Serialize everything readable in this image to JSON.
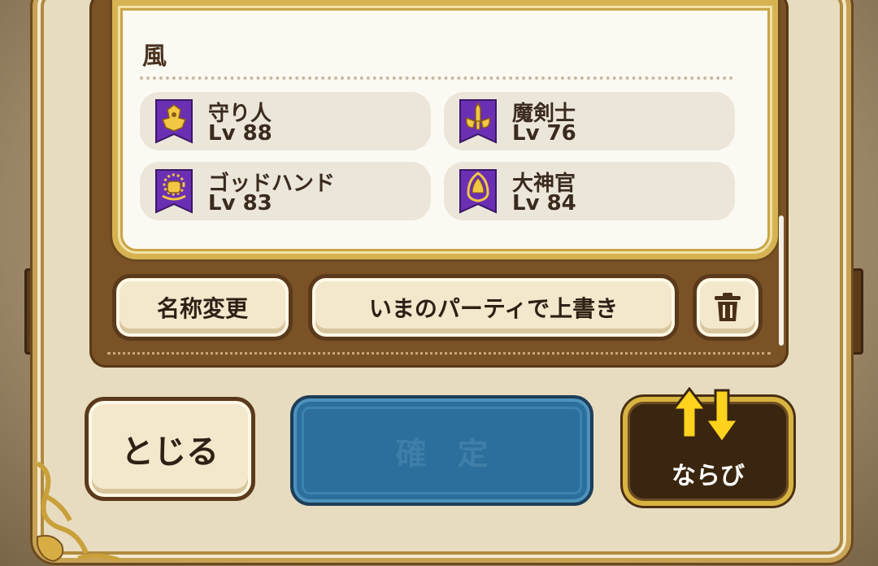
{
  "party": {
    "title": "風",
    "members": [
      {
        "name": "守り人",
        "level": "Lv 88",
        "icon": "guardian-job-icon"
      },
      {
        "name": "魔剣士",
        "level": "Lv 76",
        "icon": "magic-swordsman-job-icon"
      },
      {
        "name": "ゴッドハンド",
        "level": "Lv 83",
        "icon": "godhand-job-icon"
      },
      {
        "name": "大神官",
        "level": "Lv 84",
        "icon": "high-priest-job-icon"
      }
    ]
  },
  "actions": {
    "rename_label": "名称変更",
    "overwrite_label": "いまのパーティで上書き",
    "delete_icon": "trash-icon"
  },
  "footer": {
    "close_label": "とじる",
    "confirm_label": "確　定",
    "sort_label": "ならび",
    "sort_icon": "up-down-arrows-icon"
  },
  "colors": {
    "job_banner": "#6b2fb3",
    "confirm_button": "#2c6f9c",
    "gold_frame": "#d6b352"
  }
}
